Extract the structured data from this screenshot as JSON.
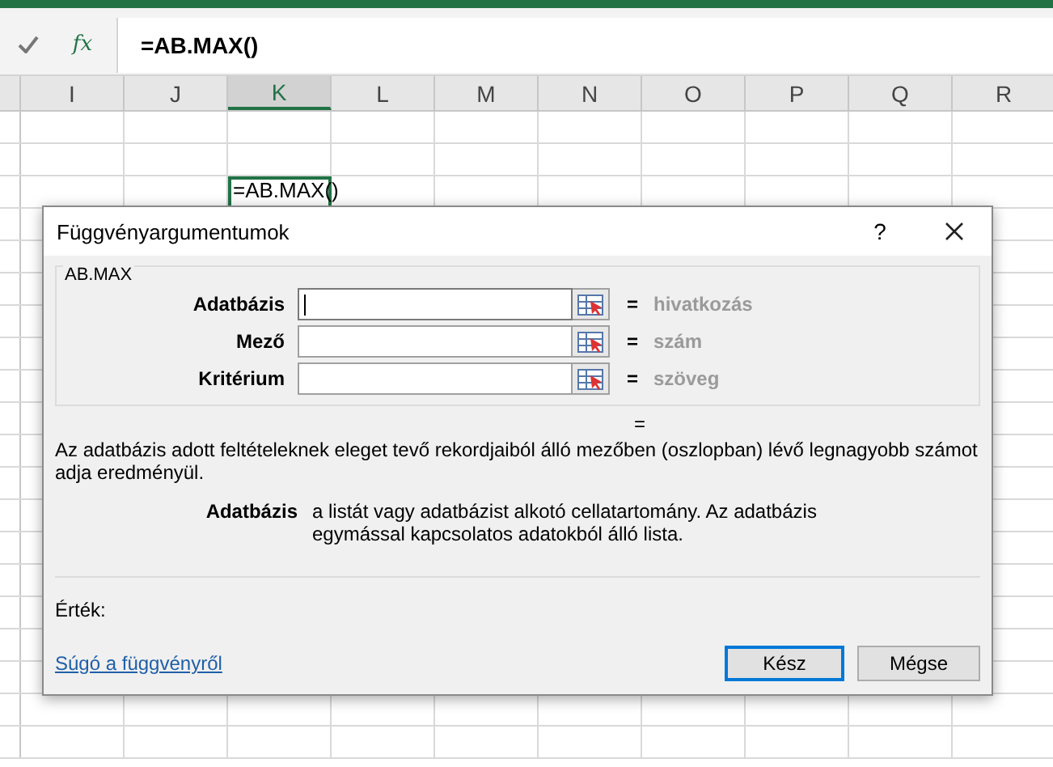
{
  "formula_bar": {
    "function_button": "fx",
    "formula": "=AB.MAX()"
  },
  "columns": [
    {
      "label": "I",
      "selected": false
    },
    {
      "label": "J",
      "selected": false
    },
    {
      "label": "K",
      "selected": true
    },
    {
      "label": "L",
      "selected": false
    },
    {
      "label": "M",
      "selected": false
    },
    {
      "label": "N",
      "selected": false
    },
    {
      "label": "O",
      "selected": false
    },
    {
      "label": "P",
      "selected": false
    },
    {
      "label": "Q",
      "selected": false
    },
    {
      "label": "R",
      "selected": false
    }
  ],
  "active_cell": {
    "value": "=AB.MAX()"
  },
  "dialog": {
    "title": "Függvényargumentumok",
    "help": "?",
    "function_name": "AB.MAX",
    "arguments": [
      {
        "label": "Adatbázis",
        "result": "hivatkozás",
        "focused": true
      },
      {
        "label": "Mező",
        "result": "szám",
        "focused": false
      },
      {
        "label": "Kritérium",
        "result": "szöveg",
        "focused": false
      }
    ],
    "equals": "=",
    "result_equals": "=",
    "description": "Az adatbázis adott feltételeknek eleget tevő rekordjaiból álló mezőben (oszlopban) lévő legnagyobb számot adja eredményül.",
    "argument_help": {
      "label": "Adatbázis",
      "text": "a listát vagy adatbázist alkotó cellatartomány. Az adatbázis egymással kapcsolatos adatokból álló lista."
    },
    "value_label": "Érték:",
    "help_link": "Súgó a függvényről",
    "buttons": [
      {
        "label": "Kész",
        "default": true
      },
      {
        "label": "Mégse",
        "default": false
      }
    ]
  }
}
